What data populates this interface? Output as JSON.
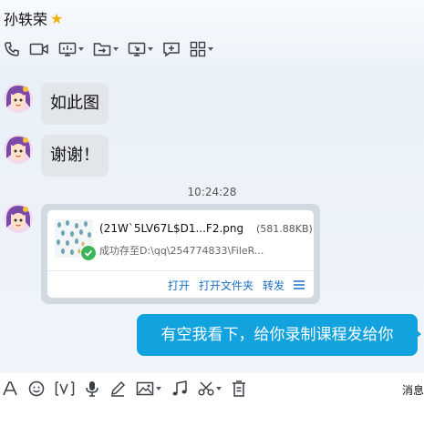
{
  "contact": {
    "name": "孙轶荣",
    "star_icon": "star-icon"
  },
  "messages": [
    {
      "direction": "incoming",
      "text": "如此图"
    },
    {
      "direction": "incoming",
      "text": "谢谢！"
    },
    {
      "direction": "incoming",
      "type": "file",
      "time": "10:24:28",
      "file_name": "(21W`5LV67L$D1...F2.png",
      "file_size": "(581.88KB)",
      "status": "成功存至D:\\qq\\254774833\\FileR...",
      "actions": [
        "打开",
        "打开文件夹",
        "转发"
      ]
    },
    {
      "direction": "outgoing",
      "text": "有空我看下，给你录制课程发给你"
    }
  ],
  "toolbar_icons": [
    "phone-icon",
    "video-call-icon",
    "screen-share-icon",
    "file-transfer-icon",
    "remote-desktop-icon",
    "add-app-icon",
    "apps-grid-icon"
  ],
  "input_toolbar": {
    "icons": [
      "font-icon",
      "emoji-icon",
      "gif-icon",
      "mic-icon",
      "pen-icon",
      "image-icon",
      "music-icon",
      "scissors-icon",
      "trash-icon"
    ],
    "history_label": "消息"
  },
  "colors": {
    "outgoing_bubble": "#12a2de",
    "incoming_bubble": "#e2e5ea",
    "action_link": "#1a6fc7",
    "star": "#f2b300"
  }
}
